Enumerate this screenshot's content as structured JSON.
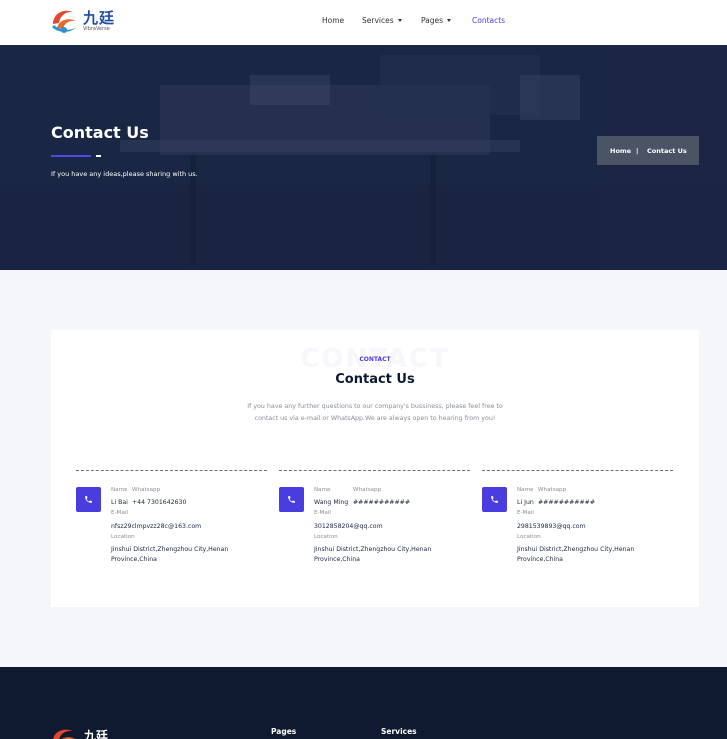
{
  "header": {
    "logo_cn": "九廷",
    "logo_en": "VibraVerse",
    "nav": {
      "home": "Home",
      "services": "Services",
      "pages": "Pages",
      "contacts": "Contacts"
    },
    "active_color": "#4a3de0"
  },
  "hero": {
    "title": "Contact Us",
    "subtitle": "If you have any ideas,please sharing with us.",
    "breadcrumb": {
      "home": "Home",
      "separator": "|",
      "current": "Contact Us"
    }
  },
  "card": {
    "ghost_text": "CONTACT",
    "eyebrow": "CONTACT",
    "title": "Contact Us",
    "description_line1": "If you have any further questions to our company's bussiness, please feel free to",
    "description_line2": "contact us via e-mail or WhatsApp.We are always open to hearing from you!",
    "contacts": [
      {
        "name_label": "Name",
        "whatsapp_label": "Whatsapp",
        "name": "Li Bai",
        "whatsapp": "+44 7301642630",
        "email_label": "E-Mail",
        "email": "nfsz29clmpvzz28c@163.com",
        "location_label": "Location",
        "location_line1": "Jinshui District,Zhengzhou City,Henan",
        "location_line2": "Province,China"
      },
      {
        "name_label": "Name",
        "whatsapp_label": "Whatsapp",
        "name": "Wang Ming",
        "whatsapp": "###########",
        "email_label": "E-Mail",
        "email": "3012858204@qq.com",
        "location_label": "Location",
        "location_line1": "Jinshui District,Zhengzhou City,Henan",
        "location_line2": "Province,China"
      },
      {
        "name_label": "Name",
        "whatsapp_label": "Whatsapp",
        "name": "Li Jun",
        "whatsapp": "###########",
        "email_label": "E-Mail",
        "email": "2981539893@qq.com",
        "location_label": "Location",
        "location_line1": "Jinshui District,Zhengzhou City,Henan",
        "location_line2": "Province,China"
      }
    ]
  },
  "footer": {
    "logo_cn": "九廷",
    "pages_heading": "Pages",
    "services_heading": "Services"
  }
}
